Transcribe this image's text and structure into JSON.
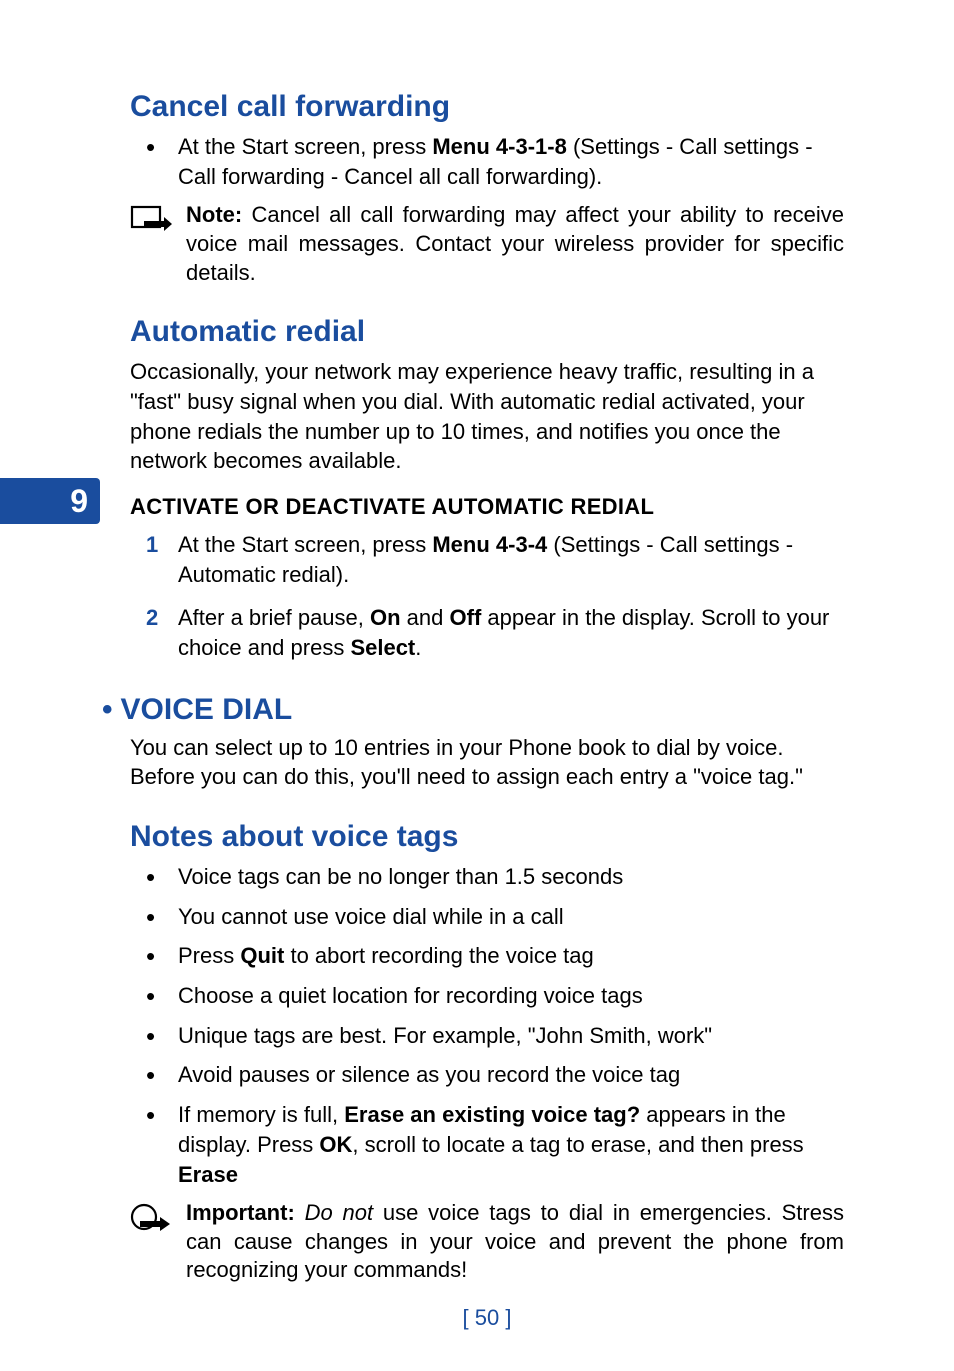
{
  "chapter_number": "9",
  "page_number": "[ 50 ]",
  "sections": {
    "cancel": {
      "heading": "Cancel call forwarding",
      "bullet_pre": "At the Start screen, press ",
      "bullet_bold": "Menu 4-3-1-8",
      "bullet_post": " (Settings - Call settings - Call forwarding - Cancel all call forwarding).",
      "note_bold": "Note:",
      "note_text": " Cancel all call forwarding may affect your ability to receive voice mail messages. Contact your wireless provider for specific details."
    },
    "auto": {
      "heading": "Automatic redial",
      "intro": "Occasionally, your network may experience heavy traffic, resulting in a \"fast\" busy signal when you dial. With automatic redial activated, your phone redials the number up to 10 times, and notifies you once the network becomes available.",
      "sub": "ACTIVATE OR DEACTIVATE AUTOMATIC REDIAL",
      "step1_pre": "At the Start screen, press ",
      "step1_bold": "Menu 4-3-4",
      "step1_post": " (Settings - Call settings - Automatic redial).",
      "step2_pre": "After a brief pause, ",
      "step2_b1": "On",
      "step2_mid1": " and ",
      "step2_b2": "Off",
      "step2_mid2": " appear in the display. Scroll to your choice and press ",
      "step2_b3": "Select",
      "step2_end": "."
    },
    "voice": {
      "heading": "VOICE DIAL",
      "intro": "You can select up to 10 entries in your Phone book to dial by voice. Before you can do this, you'll need to assign each entry a \"voice tag.\""
    },
    "notes": {
      "heading": "Notes about voice tags",
      "b1": "Voice tags can be no longer than 1.5 seconds",
      "b2": "You cannot use voice dial while in a call",
      "b3_pre": "Press ",
      "b3_bold": "Quit",
      "b3_post": " to abort recording the voice tag",
      "b4": "Choose a quiet location for recording voice tags",
      "b5": "Unique tags are best. For example, \"John Smith, work\"",
      "b6": "Avoid pauses or silence as you record the voice tag",
      "b7_pre": "If memory is full, ",
      "b7_bold1": "Erase an existing voice tag?",
      "b7_mid1": " appears in the display. Press ",
      "b7_bold2": "OK",
      "b7_mid2": ", scroll to locate a tag to erase, and then press ",
      "b7_bold3": "Erase",
      "imp_bold": "Important:",
      "imp_it": "Do not",
      "imp_text": " use voice tags to dial in emergencies. Stress can cause changes in your voice and prevent the phone from recognizing your commands!"
    }
  }
}
